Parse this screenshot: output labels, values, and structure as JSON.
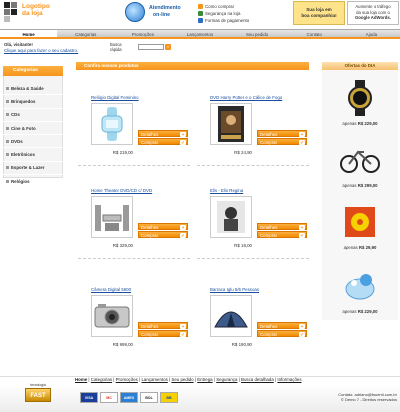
{
  "header": {
    "logo_line1": "Logotipo",
    "logo_line2": "da loja",
    "atendimento_line1": "Atendimento",
    "atendimento_line2": "on-line",
    "links": [
      "Como comprar",
      "Segurança na loja",
      "Formas de pagamento"
    ],
    "promo1_line1": "Sua loja em",
    "promo1_line2": "boa companhia!",
    "promo2_line1": "Aumente o tráfego",
    "promo2_line2": "da sua loja com o",
    "promo2_line3": "Google AdWords."
  },
  "nav": {
    "tabs": [
      "Home",
      "Categorias",
      "Promoções",
      "Lançamentos",
      "Seu pedido",
      "Contato",
      "Ajuda"
    ]
  },
  "welcome": {
    "line1": "Olá, visitante!",
    "line2": "Clique aqui para fazer o seu cadastro."
  },
  "search": {
    "label_line1": "Busca",
    "label_line2": "rápida",
    "button": "»"
  },
  "categories": {
    "title": "Categorias",
    "items": [
      "Beleza & Saúde",
      "Brinquedos",
      "CDs",
      "Cine & Foto",
      "DVDs",
      "Eletrônicos",
      "Esporte & Lazer",
      "Relógios"
    ]
  },
  "products": {
    "title": "Confira nossos produtos",
    "details_label": "Detalhes",
    "buy_label": "Comprar",
    "items": [
      {
        "name": "Relógio Digital Feminino",
        "price": "R$ 219,00"
      },
      {
        "name": "DVD Harry Potter e o Cálice de Fogo",
        "price": "R$ 24,90"
      },
      {
        "name": "Home Theater DVD/CD c/ DVD",
        "price": "R$ 329,00"
      },
      {
        "name": "Elis - Elis Regina",
        "price": "R$ 18,00"
      },
      {
        "name": "Câmera Digital 5600",
        "price": "R$ 999,00"
      },
      {
        "name": "Barraca Iglu 5/6 Pessoas",
        "price": "R$ 190,90"
      }
    ]
  },
  "offers": {
    "title": "Ofertas do DIA",
    "items": [
      {
        "price_prefix": "apenas",
        "price": "R$ 229,00"
      },
      {
        "price_prefix": "apenas",
        "price": "R$ 299,00"
      },
      {
        "price_prefix": "apenas",
        "price": "R$ 29,90"
      },
      {
        "price_prefix": "apenas",
        "price": "R$ 229,00"
      }
    ]
  },
  "footer": {
    "links": [
      "Home",
      "Categorias",
      "Promoções",
      "Lançamentos",
      "Seu pedido",
      "Entrega",
      "Segurança",
      "Busca detalhada",
      "Informações"
    ],
    "tech_label": "tecnologia",
    "tech_brand": "FAST",
    "payments": [
      "VISA",
      "MC",
      "AMEX",
      "BOL",
      "BB"
    ],
    "contact_line1": "Contato: adriano@fsuenti.com.br",
    "contact_line2": "© Demo 7 - Direitos reservados"
  },
  "colors": {
    "accent": "#f7941d",
    "link": "#1a4fa0"
  }
}
